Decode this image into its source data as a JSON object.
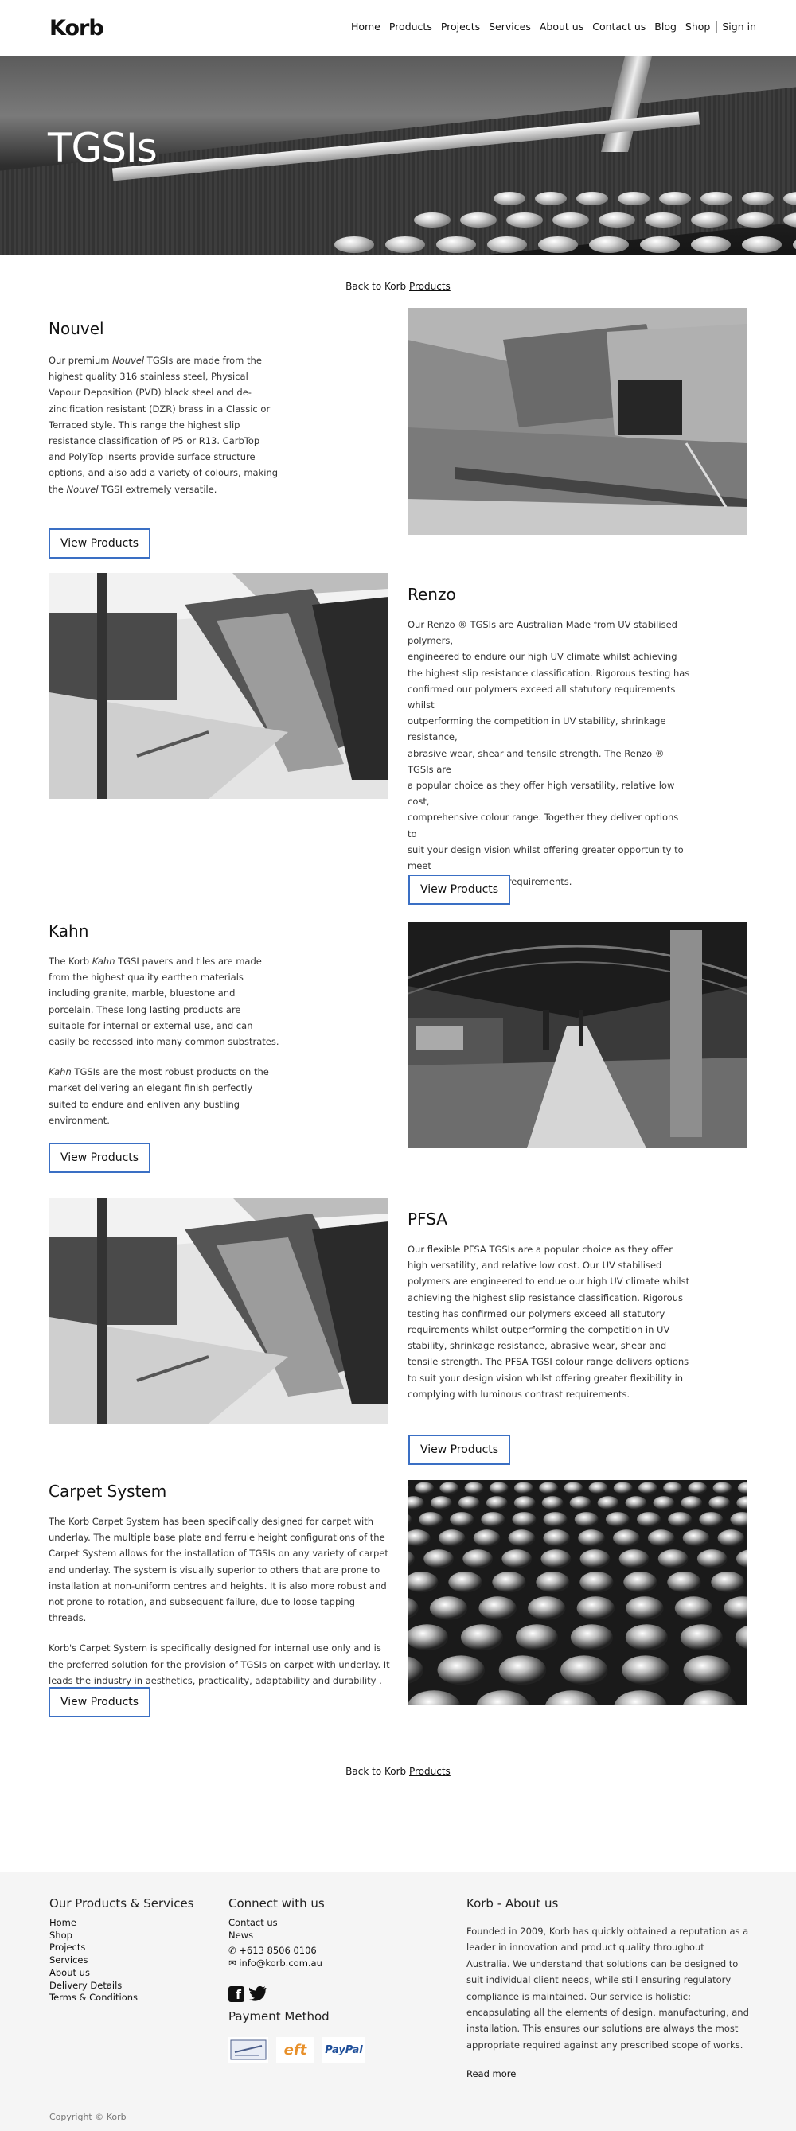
{
  "header": {
    "logo": "Korb",
    "nav": [
      "Home",
      "Products",
      "Projects",
      "Services",
      "About us",
      "Contact us",
      "Blog",
      "Shop"
    ],
    "signin": "Sign in"
  },
  "hero": {
    "title": "TGSIs"
  },
  "back_link": {
    "prefix": "Back to Korb",
    "link": "Products"
  },
  "sections": {
    "nouvel": {
      "title": "Nouvel",
      "text_a": "Our premium ",
      "text_em1": "Nouvel",
      "text_b": " TGSIs are made from the highest quality 316 stainless steel, Physical Vapour Deposition (PVD) black steel and de-zincification resistant (DZR) brass in a Classic or Terraced style. This range the highest slip resistance classification of P5 or R13. CarbTop and PolyTop inserts provide surface structure options, and also add a variety of colours, making the ",
      "text_em2": "Nouvel",
      "text_c": " TGSI extremely versatile.",
      "button": "View Products"
    },
    "renzo": {
      "title": "Renzo",
      "lines": [
        "Our Renzo ® TGSIs are Australian Made from UV stabilised polymers,",
        "engineered to endure our high UV climate whilst achieving",
        "the highest slip resistance classification. Rigorous testing has",
        "confirmed our polymers exceed all statutory requirements whilst",
        "outperforming the competition in UV stability, shrinkage resistance,",
        "abrasive wear, shear and tensile strength. The Renzo ® TGSIs are",
        "a popular choice as they offer high versatility, relative low cost,",
        "comprehensive colour range. Together they deliver options to",
        "suit your design vision whilst offering greater opportunity to meet",
        "luminous compliance requirements."
      ],
      "button": "View Products"
    },
    "kahn": {
      "title": "Kahn",
      "p1_a": "The Korb ",
      "p1_em": "Kahn",
      "p1_b": " TGSI pavers and tiles are made from the highest quality earthen materials including granite, marble, bluestone and porcelain. These long lasting products are suitable for internal or external use, and can easily be recessed into many common substrates.",
      "p2_em": "Kahn",
      "p2_b": " TGSIs are the most robust products on the market delivering an elegant finish perfectly suited to endure and enliven any bustling environment.",
      "button": "View Products"
    },
    "pfsa": {
      "title": "PFSA",
      "text": "Our flexible PFSA TGSIs are a popular choice as they offer high versatility, and relative low cost. Our UV stabilised polymers are engineered to endue our high UV climate whilst achieving the highest slip resistance classification. Rigorous testing has confirmed our polymers exceed all statutory requirements whilst outperforming the competition in UV stability, shrinkage resistance, abrasive wear, shear and tensile strength. The PFSA TGSI colour range delivers options to suit your design vision whilst offering greater flexibility in complying with luminous contrast requirements.",
      "button": "View Products"
    },
    "carpet": {
      "title": "Carpet System",
      "p1": "The Korb Carpet System has been specifically designed for carpet with underlay. The multiple base plate and ferrule height configurations of the Carpet System allows for the installation of TGSIs on any variety of carpet and underlay. The system is visually superior to others that are prone to installation at non-uniform centres and heights. It is also more robust and not prone to rotation, and subsequent failure, due to loose tapping threads.",
      "p2": "Korb's Carpet System is specifically designed for internal use only and is the preferred solution for the provision of TGSIs on carpet with underlay. It leads the industry in aesthetics, practicality, adaptability and durability .",
      "button": "View Products"
    }
  },
  "footer": {
    "products_heading": "Our Products & Services",
    "products_links": [
      "Home",
      "Shop",
      "Projects",
      "Services",
      "About us",
      "Delivery Details",
      "Terms & Conditions"
    ],
    "connect_heading": "Connect with us",
    "connect_links": [
      "Contact us",
      "News"
    ],
    "phone": "+613 8506 0106",
    "email": "info@korb.com.au",
    "payment_heading": "Payment Method",
    "payment_methods": [
      "eft",
      "PayPal"
    ],
    "about_heading": "Korb - About us",
    "about_text": "Founded in 2009, Korb has quickly obtained a reputation as a leader in innovation and product quality throughout Australia. We understand that solutions can be designed to suit individual client needs, while still ensuring regulatory compliance is maintained. Our service is holistic; encapsulating all the elements of design, manufacturing, and installation. This ensures our solutions are always the most appropriate required against any prescribed scope of works.",
    "read_more": "Read more",
    "copyright": "Copyright © Korb"
  },
  "colors": {
    "button_border": "#3a6fc4",
    "footer_bg": "#f5f5f5"
  }
}
